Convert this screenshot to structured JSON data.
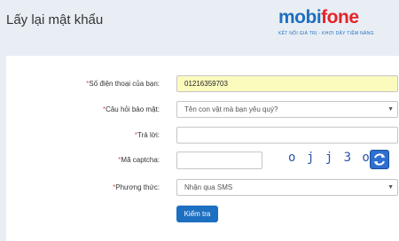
{
  "header": {
    "title": "Lấy lại mật khẩu",
    "logo": {
      "brand_part1": "mobi",
      "brand_part2": "fone",
      "tagline": "KẾT NỐI GIÁ TRỊ - KHƠI DẬY TIỀM NĂNG"
    }
  },
  "form": {
    "required_mark": "*",
    "phone": {
      "label": "Số điện thoại của bạn:",
      "value": "01216359703"
    },
    "question": {
      "label": "Câu hỏi bảo mật:",
      "selected": "Tên con vật mà bạn yêu quý?"
    },
    "answer": {
      "label": "Trả lời:",
      "value": ""
    },
    "captcha": {
      "label": "Mã captcha:",
      "value": "",
      "image_text": "o j j 3 o"
    },
    "method": {
      "label": "Phương thức:",
      "selected": "Nhận qua SMS"
    },
    "submit_label": "Kiểm tra"
  },
  "colors": {
    "brand_blue": "#1d6fc1",
    "brand_red": "#e2242a",
    "phone_field_bg": "#fbfbbe",
    "page_bg": "#e9eef5"
  },
  "icons": {
    "refresh": "refresh-icon",
    "caret": "chevron-down-icon"
  }
}
